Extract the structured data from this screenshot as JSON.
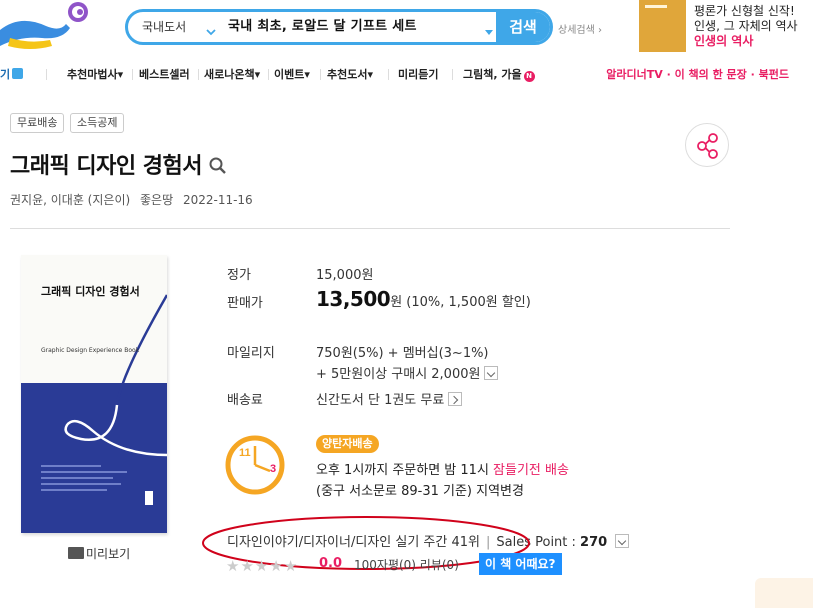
{
  "header": {
    "search": {
      "category": "국내도서",
      "query": "국내 최초, 로알드 달 기프트 세트",
      "button_label": "검색"
    },
    "advanced_search_label": "상세검색",
    "ad": {
      "line1": "평론가 신형철 신작!",
      "line2": "인생, 그 자체의 역사",
      "line3": "인생의 역사"
    }
  },
  "nav": {
    "items": [
      "기",
      "추천마법사",
      "베스트셀러",
      "새로나온책",
      "이벤트",
      "추천도서",
      "미리듣기",
      "그림책, 가을"
    ],
    "right_text": "알라디너TV · 이 책의 한 문장 · 북펀드",
    "badge_n": "N"
  },
  "tags": [
    "무료배송",
    "소득공제"
  ],
  "book": {
    "title": "그래픽 디자인 경험서",
    "authors": "권지윤, 이대훈 (지은이)",
    "publisher": "좋은땅",
    "pub_date": "2022-11-16",
    "cover_title": "그래픽 디자인 경험서",
    "cover_subtitle": "Graphic Design Experience Book",
    "preview_label": "미리보기"
  },
  "price": {
    "list_label": "정가",
    "list_value": "15,000원",
    "sale_label": "판매가",
    "sale_amount": "13,500",
    "sale_unit": "원",
    "sale_discount": "(10%, 1,500원 할인)",
    "mileage_label": "마일리지",
    "mileage_line1": "750원(5%) + 멤버십(3~1%)",
    "mileage_line2": "+ 5만원이상 구매시 2,000원",
    "shipping_label": "배송료",
    "shipping_value": "신간도서 단 1권도 무료"
  },
  "delivery": {
    "badge": "양탄자배송",
    "line1_prefix": "오후 1시까지 주문하면 밤 11시 ",
    "line1_highlight": "잠들기전 배송",
    "line2": "(중구 서소문로 89-31 기준) 지역변경",
    "clock_11": "11",
    "clock_3": "3"
  },
  "rank": {
    "category_rank": "디자인이야기/디자이너/디자인 실기 주간 41위",
    "sales_label": "Sales Point : ",
    "sales_value": "270"
  },
  "rating": {
    "score": "0.0",
    "reviews": "100자평(0)   리뷰(0)",
    "cta": "이 책 어때요?"
  },
  "colors": {
    "accent": "#3fa7e8",
    "pink": "#e91e63",
    "orange": "#f5a623",
    "cover_blue": "#2a3b96",
    "cta_blue": "#1e90ff"
  }
}
